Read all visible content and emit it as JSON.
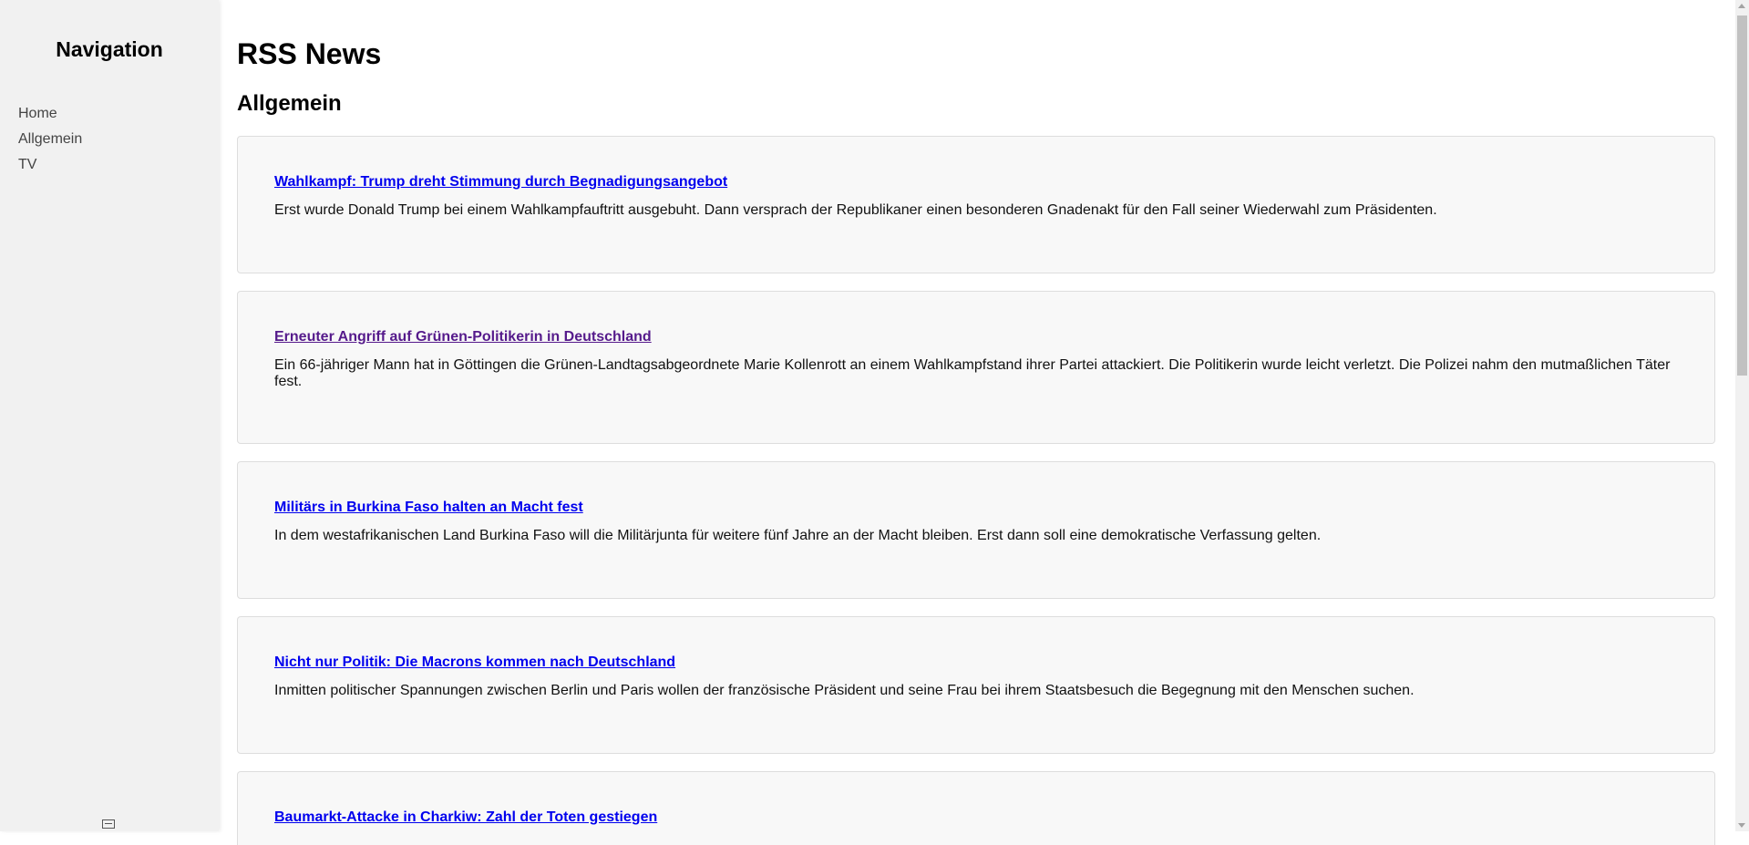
{
  "sidebar": {
    "title": "Navigation",
    "items": [
      {
        "label": "Home"
      },
      {
        "label": "Allgemein"
      },
      {
        "label": "TV"
      }
    ]
  },
  "main": {
    "title": "RSS News",
    "section": "Allgemein",
    "articles": [
      {
        "title": "Wahlkampf: Trump dreht Stimmung durch Begnadigungsangebot",
        "summary": "Erst wurde Donald Trump bei einem Wahlkampfauftritt ausgebuht. Dann versprach der Republikaner einen besonderen Gnadenakt für den Fall seiner Wiederwahl zum Präsidenten.",
        "visited": false
      },
      {
        "title": "Erneuter Angriff auf Grünen-Politikerin in Deutschland",
        "summary": "Ein 66-jähriger Mann hat in Göttingen die Grünen-Landtagsabgeordnete Marie Kollenrott an einem Wahlkampfstand ihrer Partei attackiert. Die Politikerin wurde leicht verletzt. Die Polizei nahm den mutmaßlichen Täter fest.",
        "visited": true
      },
      {
        "title": "Militärs in Burkina Faso halten an Macht fest",
        "summary": "In dem westafrikanischen Land Burkina Faso will die Militärjunta für weitere fünf Jahre an der Macht bleiben. Erst dann soll eine demokratische Verfassung gelten.",
        "visited": false
      },
      {
        "title": "Nicht nur Politik: Die Macrons kommen nach Deutschland",
        "summary": "Inmitten politischer Spannungen zwischen Berlin und Paris wollen der französische Präsident und seine Frau bei ihrem Staatsbesuch die Begegnung mit den Menschen suchen.",
        "visited": false
      },
      {
        "title": "Baumarkt-Attacke in Charkiw: Zahl der Toten gestiegen",
        "summary": "",
        "visited": false
      }
    ]
  },
  "colors": {
    "sidebar_bg": "#f1f1f1",
    "card_bg": "#f8f8f8",
    "card_border": "#dddddd",
    "link": "#0000ee",
    "link_visited": "#551a8b"
  },
  "icons": {
    "sidebar_bottom": "message-icon"
  }
}
